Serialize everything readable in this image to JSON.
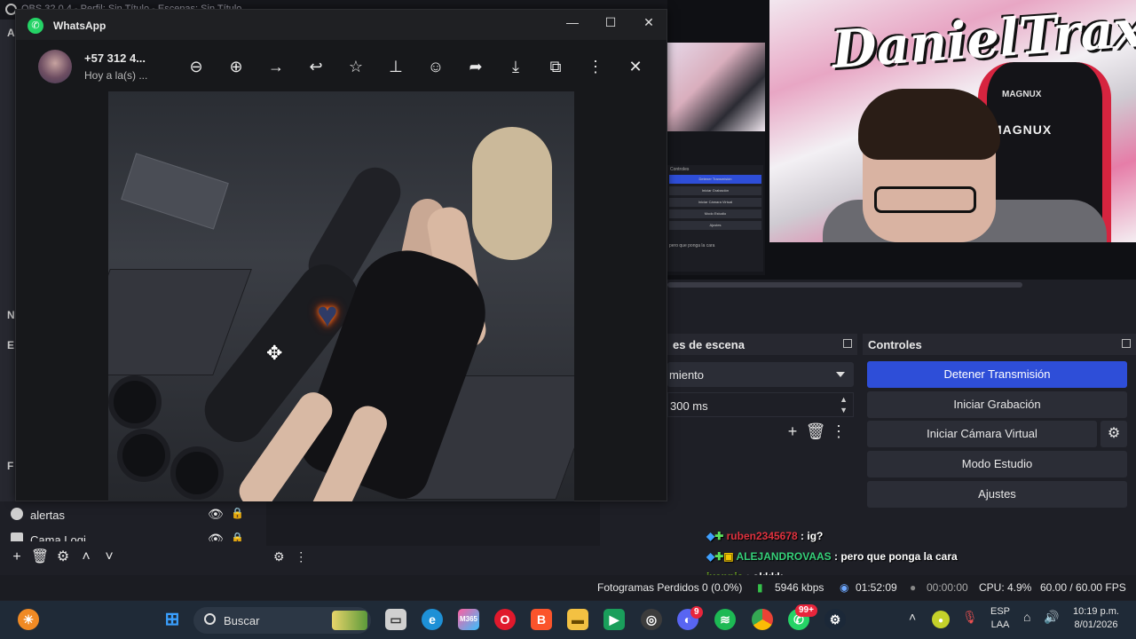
{
  "obs": {
    "window_title": "OBS 32.0.4 - Perfil: Sin Título - Escenas: Sin Título",
    "left_strip_letters": [
      "A",
      "N",
      "E",
      "F"
    ],
    "transitions": {
      "header": "Transiciones de escena",
      "header_visible": "es de escena",
      "selected": "Desvanecimiento",
      "selected_visible": "miento",
      "duration": "300 ms"
    },
    "controls": {
      "header": "Controles",
      "stop_stream": "Detener Transmisión",
      "start_recording": "Iniciar Grabación",
      "start_virtual_cam": "Iniciar Cámara Virtual",
      "studio_mode": "Modo Estudio",
      "settings": "Ajustes"
    },
    "sources": [
      {
        "name": "alertas"
      },
      {
        "name": "Cama Logi"
      }
    ],
    "status": {
      "dropped_frames": "Fotogramas Perdidos 0 (0.0%)",
      "bitrate": "5946 kbps",
      "stream_time": "01:52:09",
      "rec_time": "00:00:00",
      "cpu": "CPU: 4.9%",
      "fps": "60.00 / 60.00 FPS"
    },
    "mini_preview": {
      "controls_label": "Controles",
      "buttons": [
        "Detener Transmisión",
        "Iniciar Grabación",
        "Iniciar Cámara Virtual",
        "Modo Estudio",
        "Ajustes"
      ],
      "chat_line": "pero que ponga la cara"
    }
  },
  "camera": {
    "graffiti_text": "DanielTrax",
    "chair_brand": "MAGNUX"
  },
  "chat": [
    {
      "user": "ruben2345678",
      "message": ": ig?"
    },
    {
      "user": "ALEJANDROVAAS",
      "message": ": pero que ponga la cara"
    },
    {
      "user": "jxanpis",
      "message": ": okkkk"
    }
  ],
  "whatsapp": {
    "app_name": "WhatsApp",
    "contact": "+57 312 4...",
    "subtitle": "Hoy a la(s) ...",
    "tools": [
      "zoom-out-icon",
      "zoom-in-icon",
      "forward-arrow-icon",
      "reply-icon",
      "star-icon",
      "pin-icon",
      "emoji-icon",
      "share-icon",
      "download-icon",
      "open-external-icon",
      "more-icon",
      "close-icon"
    ]
  },
  "taskbar": {
    "search_placeholder": "Buscar",
    "whatsapp_badge": "99+",
    "discord_badge": "9",
    "language": "ESP",
    "language_sub": "LAA",
    "time": "10:19 p.m.",
    "date": "8/01/2026",
    "m365_label": "M365"
  },
  "colors": {
    "obs_bg": "#1e1f26",
    "accent_blue": "#2e4ed8",
    "whatsapp_green": "#25d366"
  }
}
